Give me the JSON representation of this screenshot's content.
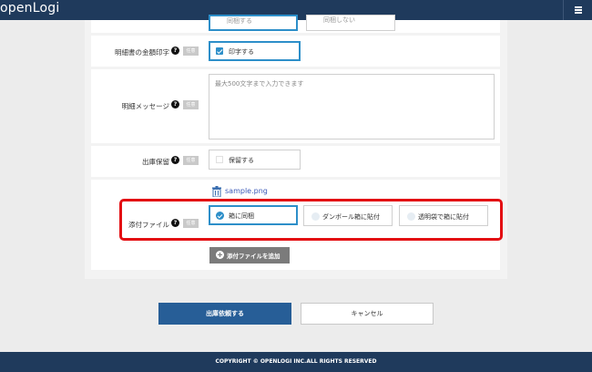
{
  "header": {
    "logo_text": "openLogi"
  },
  "rows": {
    "top_partial": {
      "option1": "同梱する",
      "option2": "同梱しない"
    },
    "print_amount": {
      "label": "明細書の金額印字",
      "tag": "任意",
      "checkbox_label": "印字する",
      "checked": true
    },
    "message": {
      "label": "明細メッセージ",
      "tag": "任意",
      "placeholder": "最大500文字まで入力できます"
    },
    "hold": {
      "label": "出庫保留",
      "tag": "任意",
      "checkbox_label": "保留する",
      "checked": false
    },
    "attachment": {
      "label": "添付ファイル",
      "tag": "任意",
      "file_name": "sample.png",
      "options": [
        {
          "label": "箱に同梱",
          "selected": true
        },
        {
          "label": "ダンボール箱に貼付",
          "selected": false
        },
        {
          "label": "透明袋で箱に貼付",
          "selected": false
        }
      ],
      "add_button": "添付ファイルを追加"
    }
  },
  "actions": {
    "submit": "出庫依頼する",
    "cancel": "キャンセル"
  },
  "footer": {
    "copyright": "COPYRIGHT © OPENLOGI INC.ALL RIGHTS RESERVED"
  },
  "colors": {
    "navbar": "#1f3a5c",
    "accent": "#2d8fc9",
    "primary_button": "#275e97",
    "highlight": "#e30f13"
  }
}
